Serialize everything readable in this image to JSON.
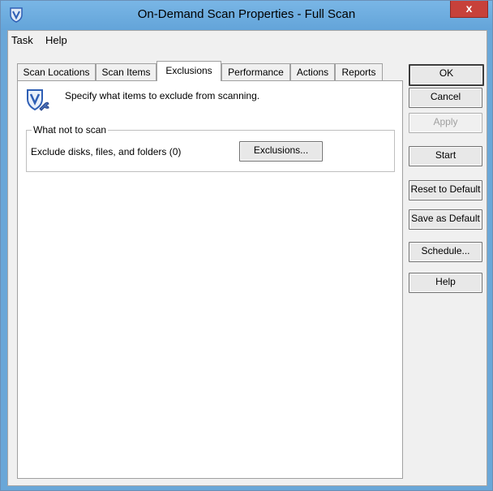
{
  "window": {
    "title": "On-Demand Scan Properties - Full Scan",
    "close_label": "x"
  },
  "menu": {
    "items": [
      "Task",
      "Help"
    ]
  },
  "tabs": [
    {
      "label": "Scan Locations",
      "active": false
    },
    {
      "label": "Scan Items",
      "active": false
    },
    {
      "label": "Exclusions",
      "active": true
    },
    {
      "label": "Performance",
      "active": false
    },
    {
      "label": "Actions",
      "active": false
    },
    {
      "label": "Reports",
      "active": false
    }
  ],
  "panel": {
    "description": "Specify what items to exclude from scanning.",
    "group": {
      "legend": "What not to scan",
      "text": "Exclude disks, files, and folders (0)",
      "button_label": "Exclusions..."
    }
  },
  "side_buttons": {
    "ok": "OK",
    "cancel": "Cancel",
    "apply": "Apply",
    "start": "Start",
    "reset_default": "Reset to Default",
    "save_default": "Save as Default",
    "schedule": "Schedule...",
    "help": "Help"
  },
  "colors": {
    "titlebar": "#6aa7d8",
    "close": "#c7413a",
    "icon_blue": "#2f5fb5"
  }
}
